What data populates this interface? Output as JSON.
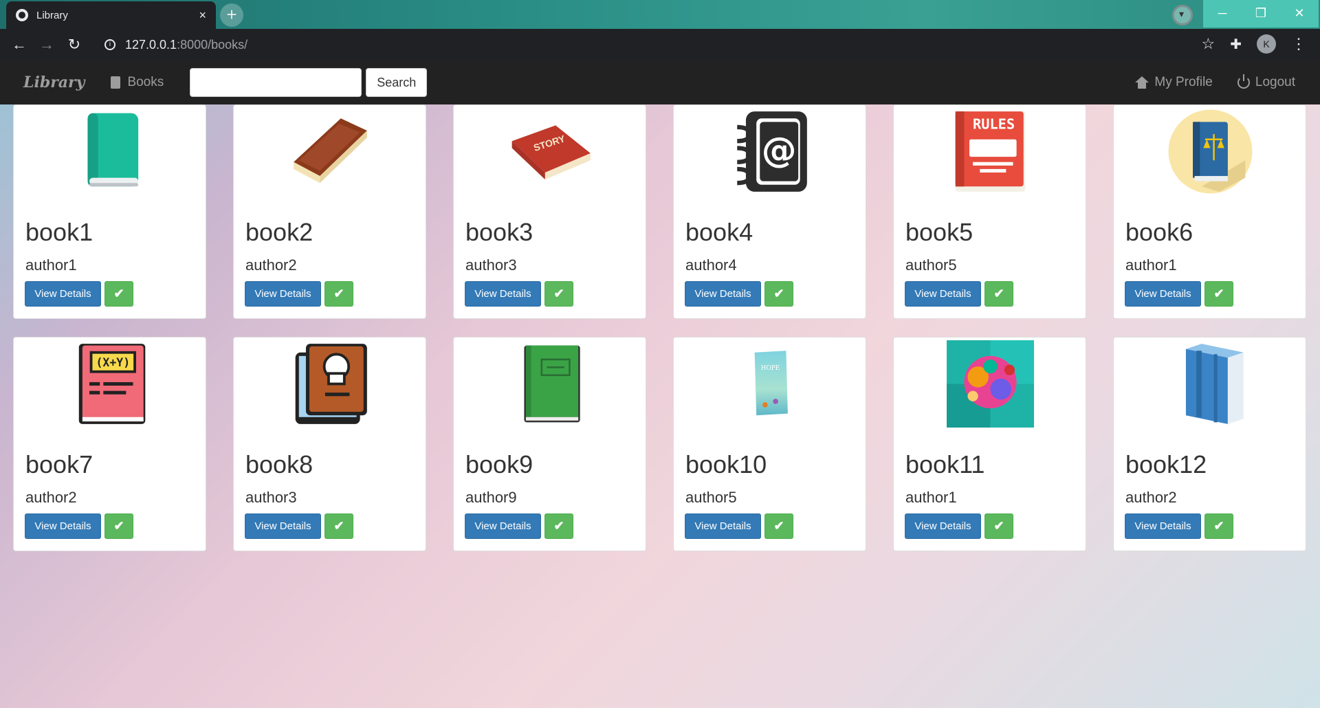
{
  "browser": {
    "tab_title": "Library",
    "tab_close": "×",
    "new_tab": "+",
    "url_host": "127.0.0.1",
    "url_path": ":8000/books/",
    "profile_initial": "K",
    "window": {
      "minimize": "─",
      "maximize": "❐",
      "close": "✕"
    }
  },
  "navbar": {
    "brand": "Library",
    "books_label": "Books",
    "search_value": "",
    "search_button": "Search",
    "profile_label": "My Profile",
    "logout_label": "Logout"
  },
  "card_common": {
    "view_label": "View Details",
    "check": "✔"
  },
  "books": [
    {
      "title": "book1",
      "author": "author1",
      "icon": "green-book-icon"
    },
    {
      "title": "book2",
      "author": "author2",
      "icon": "leather-book-icon"
    },
    {
      "title": "book3",
      "author": "author3",
      "icon": "story-book-icon"
    },
    {
      "title": "book4",
      "author": "author4",
      "icon": "address-book-icon"
    },
    {
      "title": "book5",
      "author": "author5",
      "icon": "rules-book-icon"
    },
    {
      "title": "book6",
      "author": "author1",
      "icon": "law-book-icon"
    },
    {
      "title": "book7",
      "author": "author2",
      "icon": "math-book-icon"
    },
    {
      "title": "book8",
      "author": "author3",
      "icon": "cook-book-icon"
    },
    {
      "title": "book9",
      "author": "author9",
      "icon": "green-notebook-icon"
    },
    {
      "title": "book10",
      "author": "author5",
      "icon": "hope-book-icon"
    },
    {
      "title": "book11",
      "author": "author1",
      "icon": "colorful-cover-icon"
    },
    {
      "title": "book12",
      "author": "author2",
      "icon": "blue-book-icon"
    }
  ],
  "cover_text": {
    "story": "STORY",
    "rules": "RULES",
    "math": "(X+Y)",
    "hope": "HOPE"
  }
}
